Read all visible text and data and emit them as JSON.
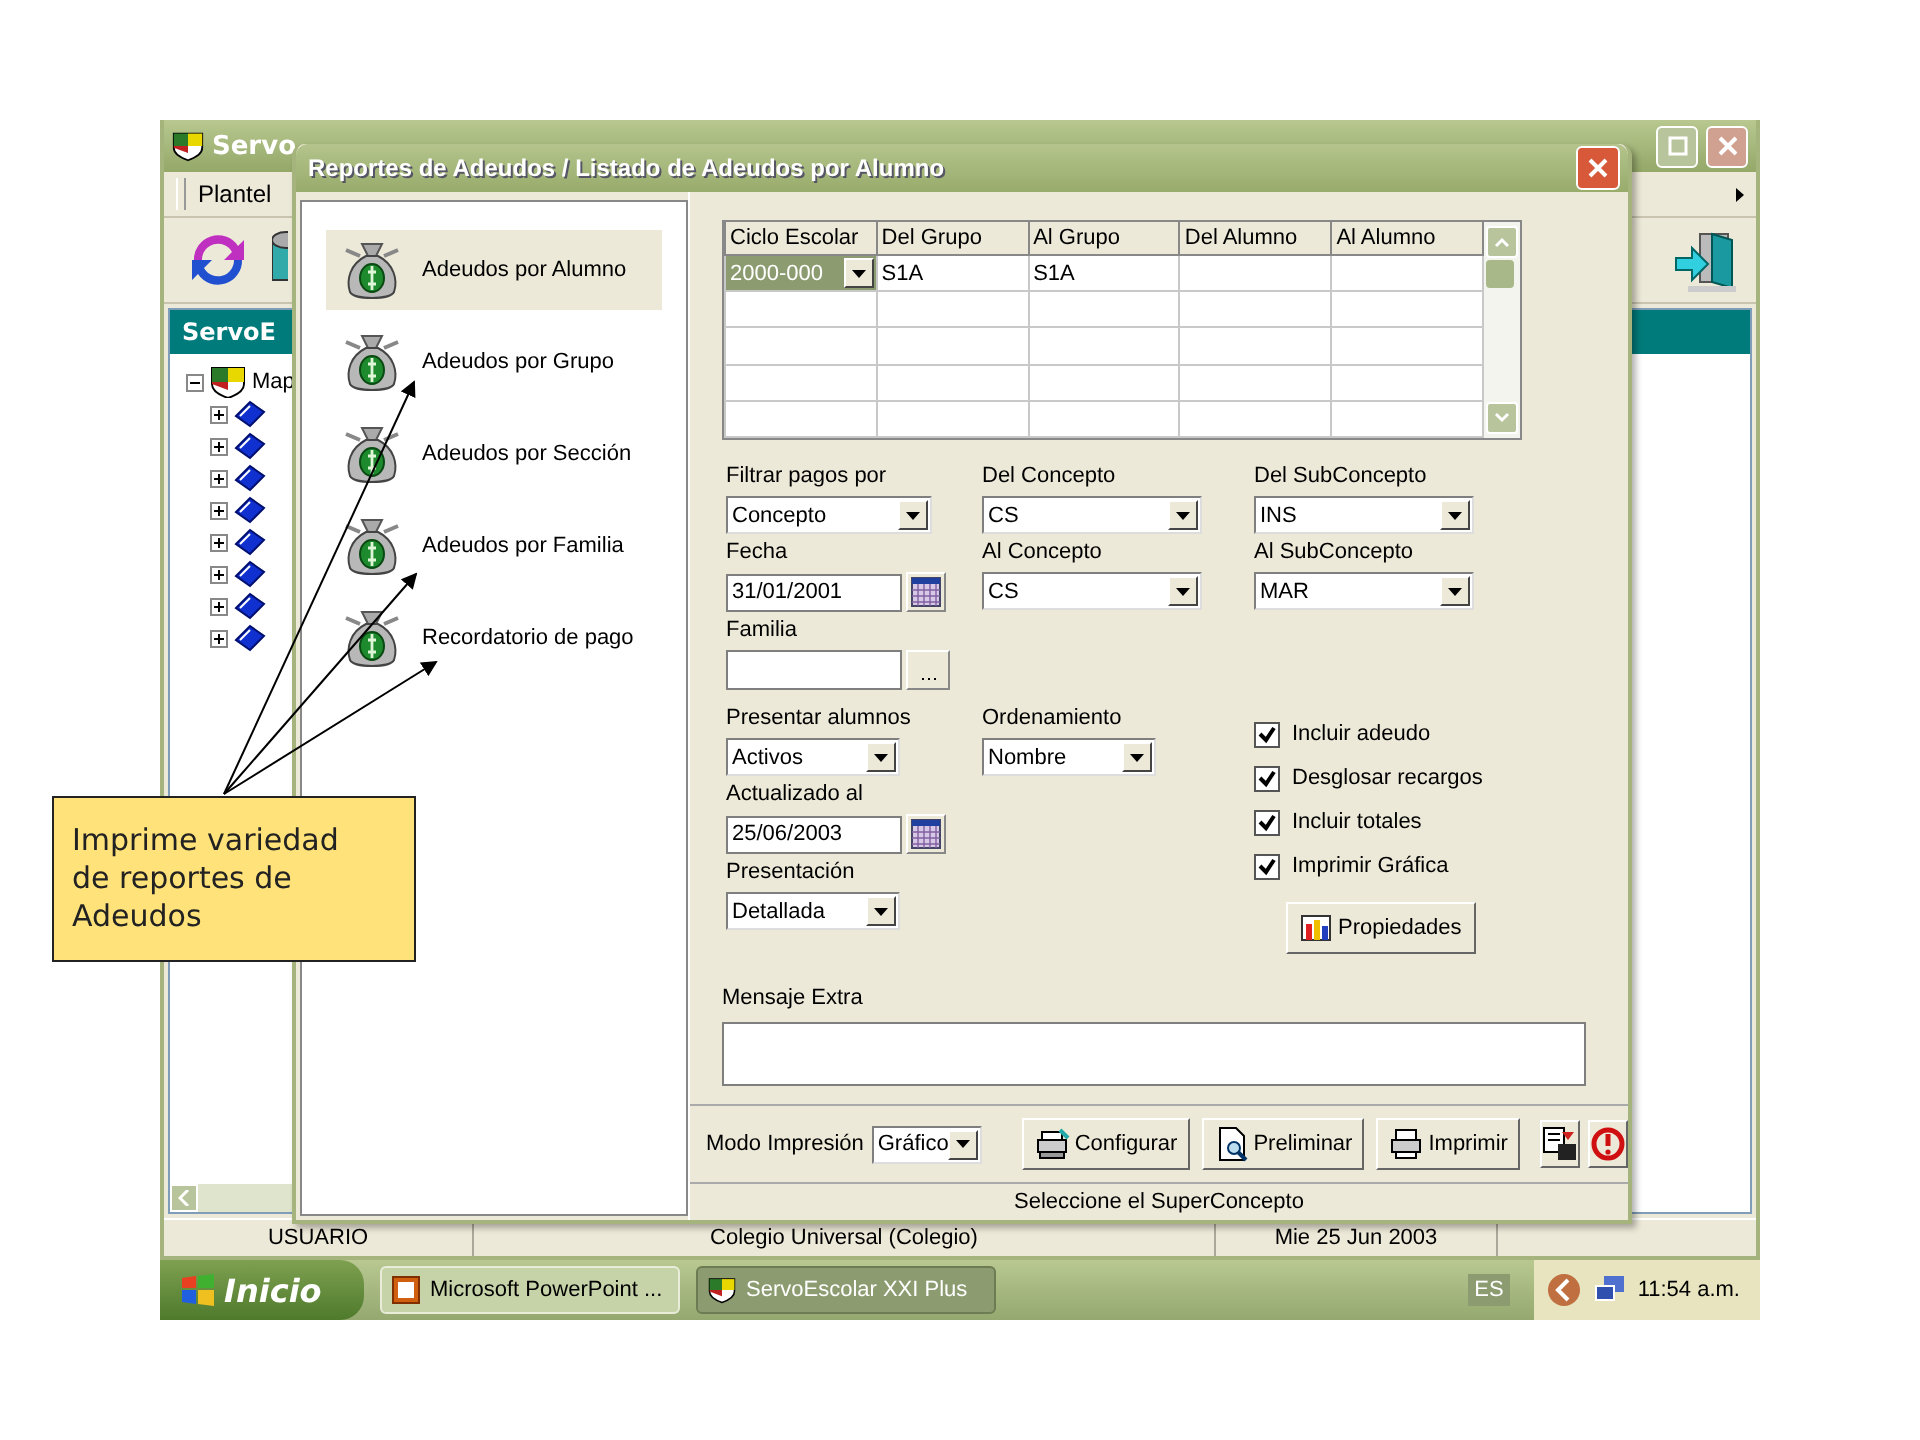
{
  "main_window": {
    "title": "Servo",
    "menu": [
      "Plantel"
    ],
    "left_panel": {
      "title": "ServoE",
      "tree": [
        {
          "label": "Map",
          "expanded": true,
          "children": [
            {
              "expanded": false
            },
            {
              "expanded": false
            },
            {
              "expanded": false
            },
            {
              "expanded": false
            },
            {
              "expanded": false
            },
            {
              "expanded": false
            },
            {
              "expanded": false
            },
            {
              "expanded": false
            }
          ]
        }
      ]
    }
  },
  "dialog": {
    "title": "Reportes de Adeudos / Listado de Adeudos por Alumno",
    "reports": [
      {
        "label": "Adeudos por Alumno",
        "selected": true
      },
      {
        "label": "Adeudos por Grupo",
        "selected": false
      },
      {
        "label": "Adeudos por Sección",
        "selected": false
      },
      {
        "label": "Adeudos por Familia",
        "selected": false
      },
      {
        "label": "Recordatorio de pago",
        "selected": false
      }
    ],
    "grid": {
      "columns": [
        "Ciclo Escolar",
        "Del Grupo",
        "Al Grupo",
        "Del Alumno",
        "Al Alumno"
      ],
      "rows": [
        {
          "cells": [
            "2000-000",
            "S1A",
            "S1A"
          ]
        }
      ]
    },
    "filters": [
      [
        {
          "label": "Filtrar pagos por",
          "kind": "combo",
          "value": "Concepto"
        },
        {
          "label": "Fecha",
          "kind": "date",
          "value": "31/01/2001"
        },
        {
          "label": "Familia",
          "kind": "lookup"
        }
      ],
      [
        {
          "label": "Del Concepto",
          "kind": "combo",
          "value": "CS"
        },
        {
          "label": "Al Concepto",
          "kind": "combo",
          "value": "CS"
        }
      ],
      [
        {
          "label": "Del SubConcepto",
          "kind": "combo",
          "value": "INS"
        },
        {
          "label": "Al SubConcepto",
          "kind": "combo",
          "value": "MAR"
        }
      ]
    ],
    "display": [
      [
        {
          "label": "Presentar alumnos",
          "kind": "combo",
          "value": "Activos"
        },
        {
          "label": "Actualizado al",
          "kind": "date",
          "value": "25/06/2003"
        },
        {
          "label": "Presentación",
          "kind": "combo",
          "value": "Detallada"
        }
      ],
      [
        {
          "label": "Ordenamiento",
          "kind": "combo",
          "value": "Nombre"
        }
      ]
    ],
    "options": [
      {
        "label": "Incluir adeudo",
        "checked": true
      },
      {
        "label": "Desglosar recargos",
        "checked": true
      },
      {
        "label": "Incluir totales",
        "checked": true
      },
      {
        "label": "Imprimir Gráfica",
        "checked": true
      }
    ],
    "properties_button": "Propiedades",
    "message": {
      "label": "Mensaje Extra"
    },
    "print_mode": {
      "label": "Modo Impresión",
      "value": "Gráfico"
    },
    "buttons": [
      {
        "label": "Configurar",
        "kind": "setup"
      },
      {
        "label": "Preliminar",
        "kind": "preview"
      },
      {
        "label": "Imprimir",
        "kind": "print"
      }
    ],
    "status": "Seleccione el SuperConcepto"
  },
  "status_bar": [
    "USUARIO",
    "Colegio Universal  (Colegio)",
    "Mie 25 Jun 2003"
  ],
  "taskbar": {
    "start": "Inicio",
    "tasks": [
      {
        "label": "Microsoft PowerPoint ...",
        "kind": "slides",
        "selected": false
      },
      {
        "label": "ServoEscolar XXI Plus",
        "kind": "shield",
        "selected": true
      }
    ],
    "language": "ES",
    "clock": "11:54 a.m."
  },
  "callout": {
    "text": "Imprime variedad de reportes de Adeudos"
  }
}
